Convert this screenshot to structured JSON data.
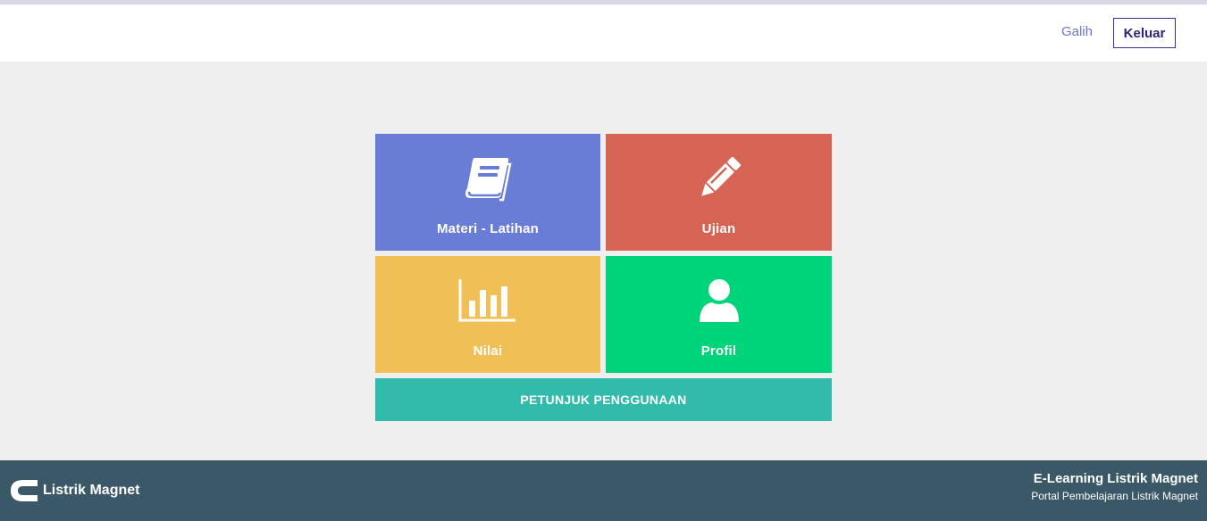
{
  "header": {
    "username": "Galih",
    "logout_label": "Keluar"
  },
  "menu": {
    "tiles": [
      {
        "label": "Materi - Latihan",
        "icon": "book-icon",
        "color": "#697cd6"
      },
      {
        "label": "Ujian",
        "icon": "pencil-icon",
        "color": "#d66453"
      },
      {
        "label": "Nilai",
        "icon": "bar-chart-icon",
        "color": "#f0bf56"
      },
      {
        "label": "Profil",
        "icon": "user-icon",
        "color": "#00d47b"
      }
    ],
    "guide_label": "PETUNJUK PENGGUNAAN",
    "guide_color": "#32bbaa"
  },
  "footer": {
    "brand": "Listrik Magnet",
    "title": "E-Learning Listrik Magnet",
    "subtitle": "Portal Pembelajaran Listrik Magnet",
    "color": "#3a5866"
  }
}
